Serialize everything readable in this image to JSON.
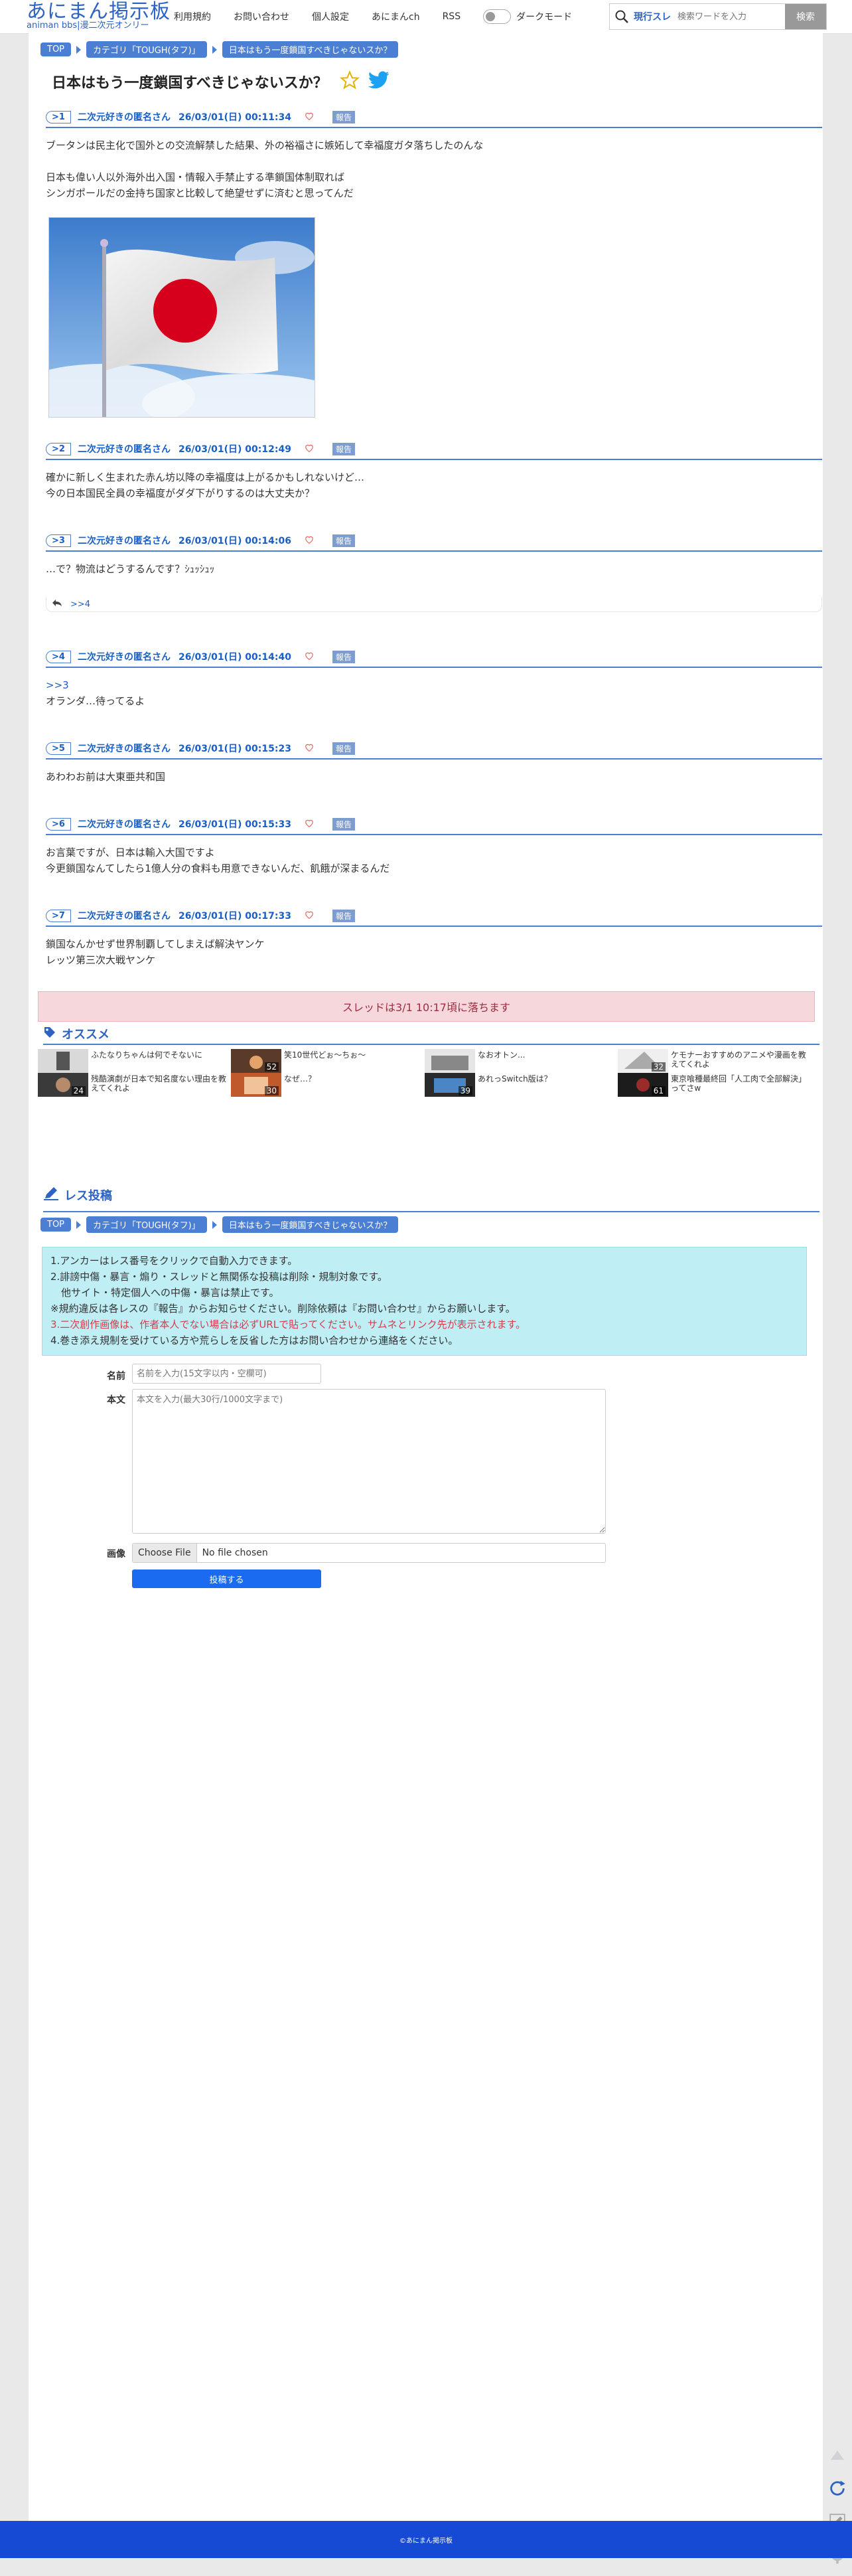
{
  "header": {
    "logo_main": "あにまん掲示板",
    "logo_sub": "animan bbs|漫二次元オンリー",
    "nav": [
      "利用規約",
      "お問い合わせ",
      "個人設定",
      "あにまんch",
      "RSS"
    ],
    "dark_mode_label": "ダークモード",
    "search_mode": "現行スレ",
    "search_placeholder": "検索ワードを入力",
    "search_button": "検索"
  },
  "breadcrumb": [
    "TOP",
    "カテゴリ「TOUGH(タフ)」",
    "日本はもう一度鎖国すべきじゃないスか？"
  ],
  "thread_title": "日本はもう一度鎖国すべきじゃないスか？",
  "report_label": "報告",
  "posts": [
    {
      "no": ">1",
      "name": "二次元好きの匿名さん",
      "date": "26/03/01(日) 00:11:34",
      "body": "ブータンは民主化で国外との交流解禁した結果、外の裕福さに嫉妬して幸福度ガタ落ちしたのんな\n\n日本も偉い人以外海外出入国・情報入手禁止する準鎖国体制取れば\nシンガポールだの金持ち国家と比較して絶望せずに済むと思ってんだ"
    },
    {
      "no": ">2",
      "name": "二次元好きの匿名さん",
      "date": "26/03/01(日) 00:12:49",
      "body": "確かに新しく生まれた赤ん坊以降の幸福度は上がるかもしれないけど…\n今の日本国民全員の幸福度がダダ下がりするのは大丈夫か？"
    },
    {
      "no": ">3",
      "name": "二次元好きの匿名さん",
      "date": "26/03/01(日) 00:14:06",
      "body": "…で？物流はどうするんです？ｼｭｯｼｭｯ",
      "reply": ">>4"
    },
    {
      "no": ">4",
      "name": "二次元好きの匿名さん",
      "date": "26/03/01(日) 00:14:40",
      "anchor": ">>3",
      "body": "オランダ…待ってるよ"
    },
    {
      "no": ">5",
      "name": "二次元好きの匿名さん",
      "date": "26/03/01(日) 00:15:23",
      "body": "あわわお前は大東亜共和国"
    },
    {
      "no": ">6",
      "name": "二次元好きの匿名さん",
      "date": "26/03/01(日) 00:15:33",
      "body": "お言葉ですが、日本は輸入大国ですよ\n今更鎖国なんてしたら1億人分の食料も用意できないんだ、飢餓が深まるんだ"
    },
    {
      "no": ">7",
      "name": "二次元好きの匿名さん",
      "date": "26/03/01(日) 00:17:33",
      "body": "鎖国なんかせず世界制覇してしまえば解決ヤンケ\nレッツ第三次大戦ヤンケ"
    }
  ],
  "thread_notice": "スレッドは3/1 10:17頃に落ちます",
  "recommend": {
    "title": "オススメ",
    "items": [
      {
        "text": "ふたなりちゃんは何でそないに",
        "count": ""
      },
      {
        "text": "笑10世代どぉ〜ちぉ〜",
        "count": "52"
      },
      {
        "text": "なおオトン...",
        "count": ""
      },
      {
        "text": "ケモナーおすすめのアニメや漫画を教えてくれよ",
        "count": "32"
      },
      {
        "text": "残酷演劇が日本で知名度ない理由を教えてくれよ",
        "count": "24"
      },
      {
        "text": "なぜ…？",
        "count": "30"
      },
      {
        "text": "あれっSwitch版は？",
        "count": "39"
      },
      {
        "text": "東京喰種最終回「人工肉で全部解決」ってさw",
        "count": "61"
      }
    ]
  },
  "reply_form": {
    "title": "レス投稿",
    "rules": [
      "1.アンカーはレス番号をクリックで自動入力できます。",
      "2.誹謗中傷・暴言・煽り・スレッドと無関係な投稿は削除・規制対象です。",
      "他サイト・特定個人への中傷・暴言は禁止です。",
      "※規約違反は各レスの『報告』からお知らせください。削除依頼は『お問い合わせ』からお願いします。",
      "3.二次創作画像は、作者本人でない場合は必ずURLで貼ってください。サムネとリンク先が表示されます。",
      "4.巻き添え規制を受けている方や荒らしを反省した方はお問い合わせから連絡をください。"
    ],
    "name_label": "名前",
    "name_placeholder": "名前を入力(15文字以内・空欄可)",
    "body_label": "本文",
    "body_placeholder": "本文を入力(最大30行/1000文字まで)",
    "image_label": "画像",
    "file_button": "Choose File",
    "file_status": "No file chosen",
    "submit": "投稿する"
  },
  "footer": "©あにまん掲示板",
  "colors": {
    "accent": "#4a7fd4",
    "footer": "#1649d4",
    "notice_bg": "#f6d7dc",
    "rules_bg": "#bfeef5"
  }
}
